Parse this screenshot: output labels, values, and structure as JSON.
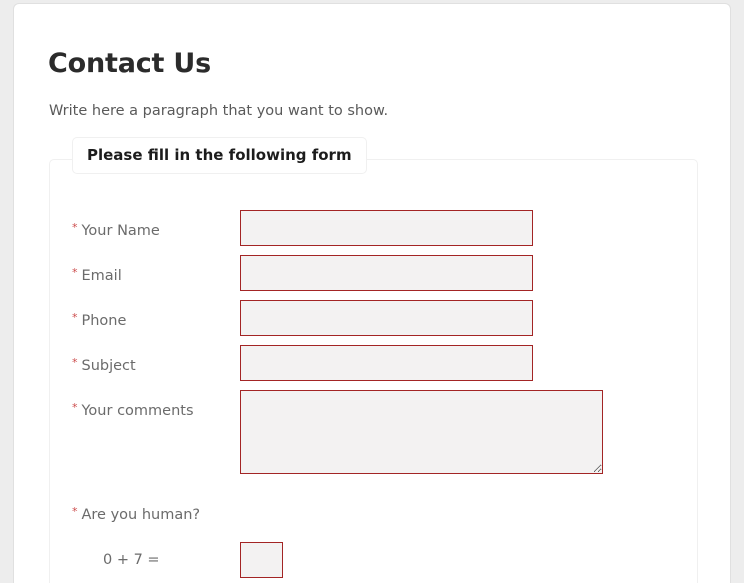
{
  "page": {
    "title": "Contact Us",
    "intro": "Write here a paragraph that you want to show.",
    "background_color": "#ededed",
    "card_color": "#ffffff"
  },
  "form": {
    "legend": "Please fill in the following form",
    "required_marker": "*",
    "field_border_color": "#a32525",
    "field_fill_color": "#f3f2f2",
    "required_marker_color": "#cc4b4b",
    "fields": [
      {
        "label": "Your Name",
        "value": "",
        "placeholder": "",
        "type": "text"
      },
      {
        "label": "Email",
        "value": "",
        "placeholder": "",
        "type": "text"
      },
      {
        "label": "Phone",
        "value": "",
        "placeholder": "",
        "type": "text"
      },
      {
        "label": "Subject",
        "value": "",
        "placeholder": "",
        "type": "text"
      },
      {
        "label": "Your comments",
        "value": "",
        "placeholder": "",
        "type": "textarea"
      }
    ],
    "captcha": {
      "label": "Are you human?",
      "expression": "0 + 7 =",
      "value": "",
      "placeholder": ""
    }
  }
}
